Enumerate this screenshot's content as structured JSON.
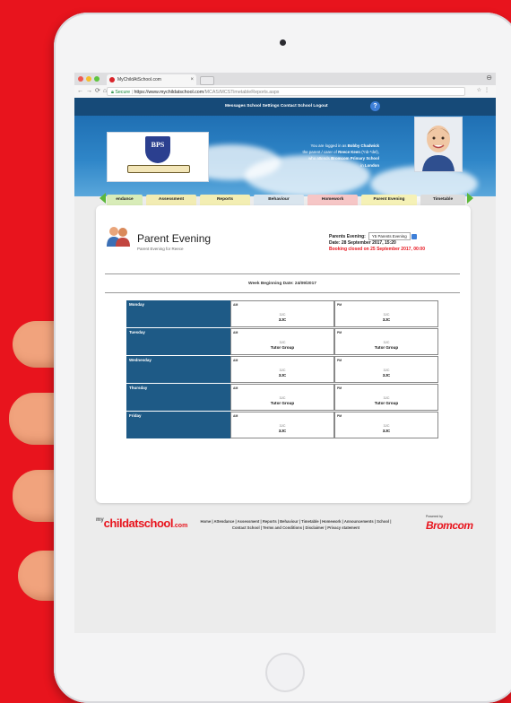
{
  "browser": {
    "tab_title": "MyChildAtSchool.com",
    "tab_close": "×",
    "url_secure": "Secure",
    "url_prefix": "https://www.mychildatschool.com",
    "url_path": "/MCAS/MCSTimetableReports.aspx"
  },
  "topbar": {
    "links": "Messages  School  Settings  Contact School  Logout",
    "help": "?"
  },
  "school": {
    "initials": "BPS"
  },
  "userinfo": {
    "line1_prefix": "You are logged in as",
    "user": "Bobby Chadwick",
    "line2_prefix": "the parent / carer of",
    "child": "Reece Keen",
    "line2_suffix": "(*nb-*del),",
    "line3_prefix": "who attends",
    "school": "Bromcom Primary School",
    "line4_prefix": "in",
    "location": "London"
  },
  "tabs": [
    {
      "label": "endance",
      "color": "#d8ecb8"
    },
    {
      "label": "Assessment",
      "color": "#f2ecb3"
    },
    {
      "label": "Reports",
      "color": "#f3eeb3"
    },
    {
      "label": "Behaviour",
      "color": "#d9e5ee"
    },
    {
      "label": "Homework",
      "color": "#f6c6c6"
    },
    {
      "label": "Parent Evening",
      "color": "#f5f1b6"
    },
    {
      "label": "Timetable",
      "color": "#dcdcdc"
    }
  ],
  "page": {
    "title": "Parent Evening",
    "subtitle": "Parent Evening for Reece",
    "pe_label": "Parents Evening:",
    "pe_value": "Y5 Parents Evening",
    "date_line": "Date: 28 September 2017, 15:20",
    "closed_line": "Booking closed on 25 September 2017, 00:00",
    "week": "Week Beginning Date: 24/09/2017"
  },
  "schedule": [
    {
      "day": "Monday",
      "am": {
        "tag": "AM",
        "l1": "3JC",
        "l2": "3JC"
      },
      "pm": {
        "tag": "PM",
        "l1": "3JC",
        "l2": "3JC"
      }
    },
    {
      "day": "Tuesday",
      "am": {
        "tag": "AM",
        "l1": "3JC",
        "l2": "Tutor Group"
      },
      "pm": {
        "tag": "PM",
        "l1": "3JC",
        "l2": "Tutor Group"
      }
    },
    {
      "day": "Wednesday",
      "am": {
        "tag": "AM",
        "l1": "3JC",
        "l2": "3JC"
      },
      "pm": {
        "tag": "PM",
        "l1": "3JC",
        "l2": "3JC"
      }
    },
    {
      "day": "Thursday",
      "am": {
        "tag": "AM",
        "l1": "3JC",
        "l2": "Tutor Group"
      },
      "pm": {
        "tag": "PM",
        "l1": "3JC",
        "l2": "Tutor Group"
      }
    },
    {
      "day": "Friday",
      "am": {
        "tag": "AM",
        "l1": "3JC",
        "l2": "3JC"
      },
      "pm": {
        "tag": "PM",
        "l1": "3JC",
        "l2": "3JC"
      }
    }
  ],
  "footer": {
    "logo_my": "my",
    "logo_main": "childatschool",
    "logo_com": ".com",
    "links_line1": "Home | Attendance | Assessment | Reports | Behaviour | Timetable | Homework | Announcements | School |",
    "links_line2": "Contact School | Terms and Conditions | Disclaimer | Privacy statement",
    "powered": "Powered by",
    "brand": "Bromcom"
  }
}
